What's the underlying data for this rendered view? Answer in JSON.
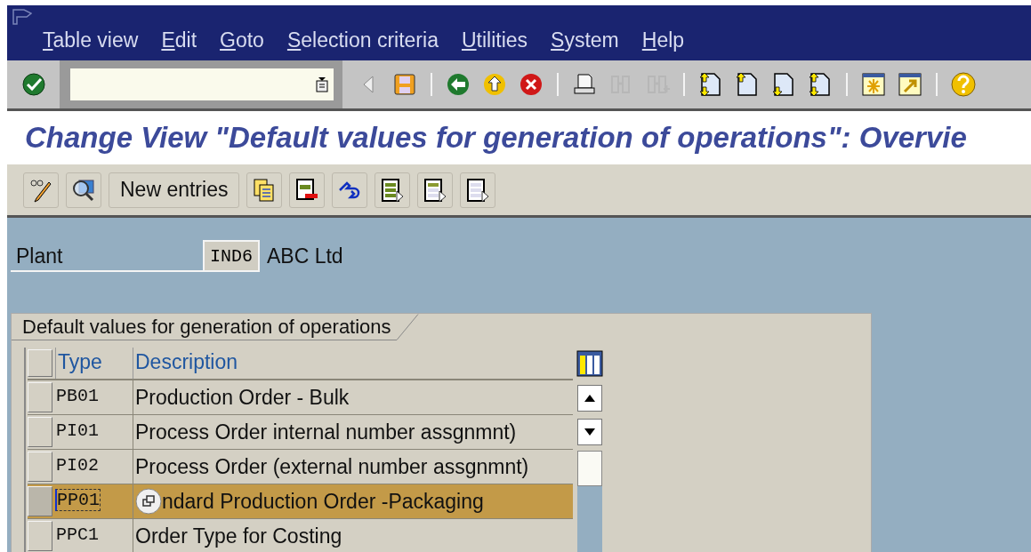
{
  "menu": [
    {
      "label": "Table view"
    },
    {
      "label": "Edit"
    },
    {
      "label": "Goto"
    },
    {
      "label": "Selection criteria"
    },
    {
      "label": "Utilities"
    },
    {
      "label": "System"
    },
    {
      "label": "Help"
    }
  ],
  "toolbar": {
    "enter": {
      "disabled": false
    },
    "groups": [
      [
        {
          "kind": "triangle",
          "disabled": false
        },
        {
          "kind": "save",
          "disabled": false
        }
      ],
      [
        {
          "kind": "back",
          "disabled": false
        },
        {
          "kind": "exit",
          "disabled": false
        },
        {
          "kind": "cancel",
          "disabled": false
        }
      ],
      [
        {
          "kind": "print",
          "disabled": false
        },
        {
          "kind": "find",
          "disabled": true
        },
        {
          "kind": "find-next",
          "disabled": true
        }
      ],
      [
        {
          "kind": "first-page",
          "disabled": false
        },
        {
          "kind": "previous-page",
          "disabled": false
        },
        {
          "kind": "next-page",
          "disabled": false
        },
        {
          "kind": "last-page",
          "disabled": false
        }
      ],
      [
        {
          "kind": "new-session",
          "disabled": false
        },
        {
          "kind": "shortcut",
          "disabled": false
        }
      ],
      [
        {
          "kind": "help",
          "disabled": false
        }
      ]
    ]
  },
  "title": "Change View \"Default values for generation of operations\": Overvie",
  "app_toolbar": [
    {
      "kind": "display-change"
    },
    {
      "kind": "details"
    },
    {
      "kind": "text",
      "label": "New entries"
    },
    {
      "kind": "copy"
    },
    {
      "kind": "delete"
    },
    {
      "kind": "undo"
    },
    {
      "kind": "select-all"
    },
    {
      "kind": "select-block"
    },
    {
      "kind": "deselect-all"
    }
  ],
  "plant": {
    "label": "Plant",
    "value": "IND6",
    "description": "ABC Ltd"
  },
  "group": {
    "title": "Default values for generation of operations"
  },
  "table": {
    "columns": [
      "Type",
      "Description"
    ],
    "rows": [
      {
        "type": "PB01",
        "description": "Production Order - Bulk",
        "selected": false,
        "focused": false
      },
      {
        "type": "PI01",
        "description": "Process Order internal number assgnmnt)",
        "selected": false,
        "focused": false
      },
      {
        "type": "PI02",
        "description": "Process Order (external number assgnmnt)",
        "selected": false,
        "focused": false
      },
      {
        "type": "PP01",
        "description": "ndard Production Order -Packaging",
        "selected": true,
        "focused": true
      },
      {
        "type": "PPC1",
        "description": "Order Type for Costing",
        "selected": false,
        "focused": false
      }
    ]
  }
}
